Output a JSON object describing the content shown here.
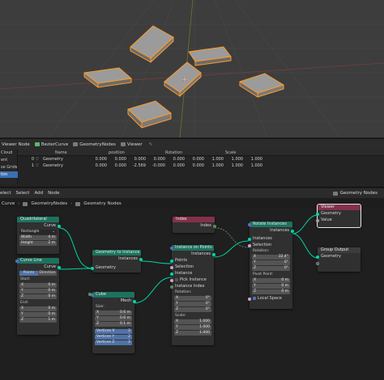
{
  "spreadsheet": {
    "header": [
      "Viewer Node",
      "BezierCurve",
      "GeometryNodes",
      "Viewer"
    ],
    "side_items": [
      "Cloud",
      "ent",
      "se Grids",
      "tim"
    ],
    "columns": [
      "Name",
      "position",
      "Rotation",
      "Scale"
    ],
    "rows": [
      {
        "index": "0",
        "name": "Geometry",
        "pos": [
          "0.000",
          "0.000",
          "0.000"
        ],
        "rot": [
          "0.000",
          "0.000",
          "0.000"
        ],
        "scale": [
          "1.000",
          "1.000",
          "1.000"
        ]
      },
      {
        "index": "1",
        "name": "Geometry",
        "pos": [
          "0.000",
          "0.000",
          "-2.569"
        ],
        "rot": [
          "-0.000",
          "0.000",
          "0.000"
        ],
        "scale": [
          "1.000",
          "1.000",
          "1.000"
        ]
      }
    ]
  },
  "node_editor": {
    "menus": [
      "elect",
      "Select",
      "Add",
      "Node"
    ],
    "breadcrumb": [
      "Curve",
      "GeometryNodes",
      "Geometry Nodes"
    ],
    "tree_name": "Geometry Nodes"
  },
  "nodes": {
    "quadrilateral": {
      "title": "Quadrilateral",
      "out": "Curve",
      "mode": "Rectangle",
      "width_label": "Width",
      "width": "4 m",
      "height_label": "Height",
      "height": "2 m"
    },
    "curve_line": {
      "title": "Curve Line",
      "out": "Curve",
      "seg_a": "Points",
      "seg_b": "Direction",
      "start": "Start:",
      "x": "X",
      "x_val": "0 m",
      "y": "Y",
      "y_val": "0 m",
      "z": "Z",
      "z_val": "0 m",
      "end": "End:",
      "ex": "X",
      "ex_val": "0 m",
      "ey": "Y",
      "ey_val": "0 m",
      "ez": "Z",
      "ez_val": "1 m"
    },
    "g2i": {
      "title": "Geometry to Instance",
      "out": "Instances",
      "in": "Geometry"
    },
    "cube": {
      "title": "Cube",
      "out": "Mesh",
      "size": "Size:",
      "x": "X",
      "xv": "0.6 m",
      "y": "Y",
      "yv": "0.6 m",
      "z": "Z",
      "zv": "0.1 m",
      "vx": "Vertices X",
      "vxv": "2",
      "vy": "Vertices Y",
      "vyv": "2",
      "vz": "Vertices Z",
      "vzv": "2"
    },
    "index": {
      "title": "Index",
      "out": "Index"
    },
    "iop": {
      "title": "Instance on Points",
      "out": "Instances",
      "points": "Points",
      "selection": "Selection",
      "instance": "Instance",
      "pick": "Pick Instance",
      "inst_index": "Instance Index",
      "rotation": "Rotation:",
      "rx": "X",
      "rxv": "0°",
      "ry": "Y",
      "ryv": "0°",
      "rz": "Z",
      "rzv": "0°",
      "scale": "Scale:",
      "sx": "X",
      "sxv": "1.000",
      "sy": "Y",
      "syv": "1.000",
      "sz": "Z",
      "szv": "1.000"
    },
    "rotate": {
      "title": "Rotate Instances",
      "out": "Instances",
      "in": "Instances",
      "selection": "Selection",
      "rotation": "Rotation:",
      "x": "X",
      "xv": "32.4°",
      "y": "Y",
      "yv": "0°",
      "z": "Z",
      "zv": "0°",
      "pivot": "Pivot Point:",
      "px": "X",
      "pxv": "0 m",
      "py": "Y",
      "pyv": "0 m",
      "pz": "Z",
      "pzv": "0 m",
      "local": "Local Space"
    },
    "viewer": {
      "title": "Viewer",
      "geometry": "Geometry",
      "value": "Value"
    },
    "group_output": {
      "title": "Group Output",
      "geometry": "Geometry"
    }
  }
}
